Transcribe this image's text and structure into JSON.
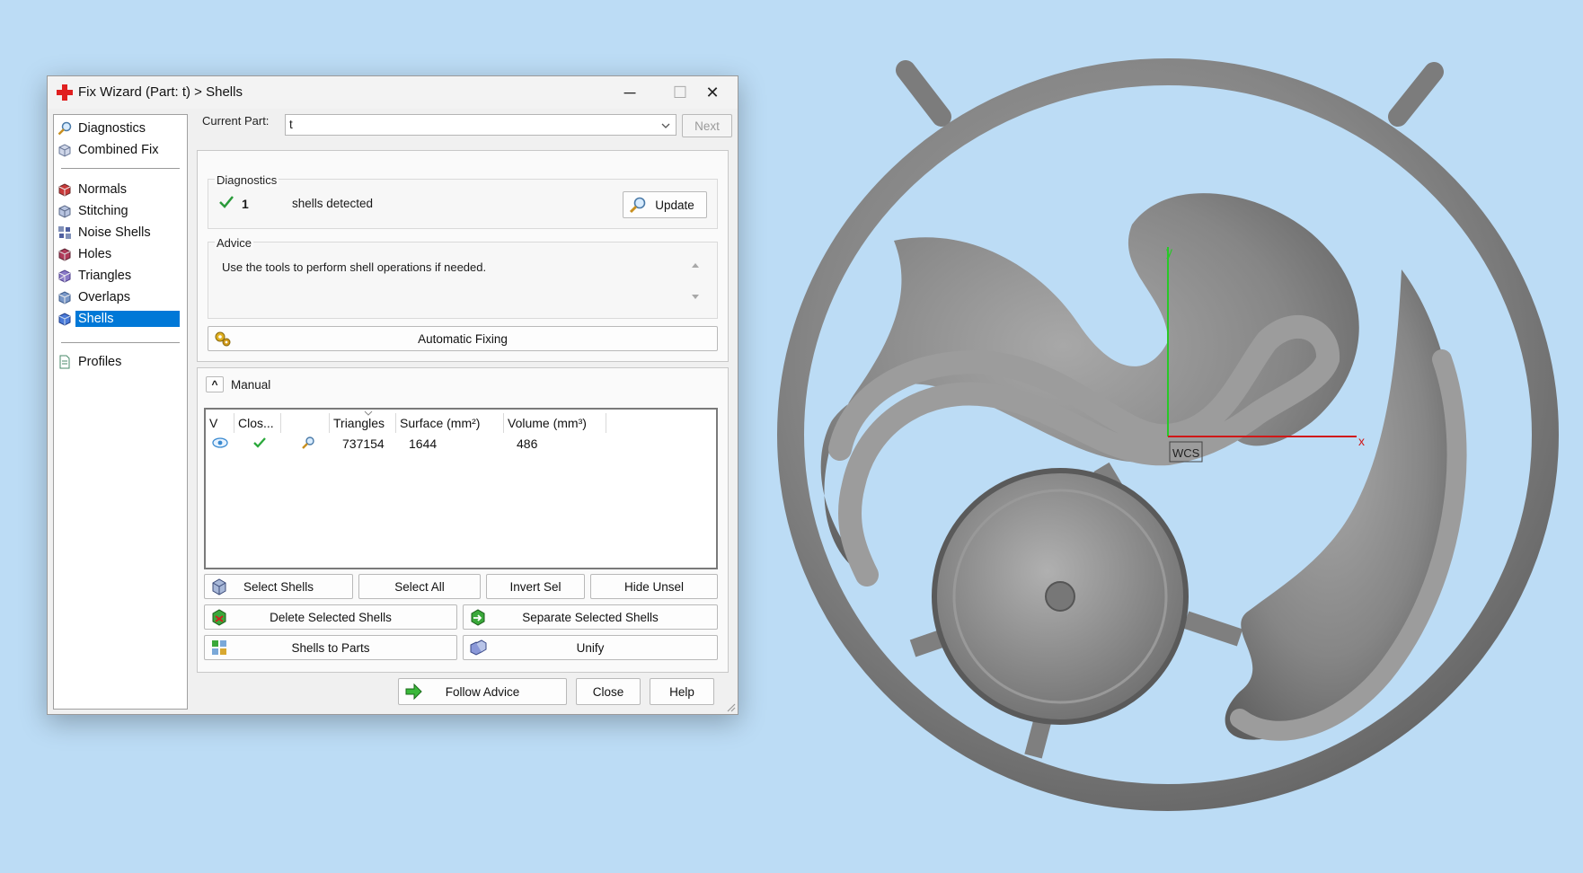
{
  "window": {
    "title": "Fix Wizard (Part: t) > Shells",
    "minimize_glyph": "─",
    "maximize_glyph": "☐",
    "close_glyph": "✕"
  },
  "sidebar": {
    "items": [
      {
        "label": "Diagnostics",
        "icon": "magnifier-icon"
      },
      {
        "label": "Combined Fix",
        "icon": "cube-icon"
      },
      {
        "label": "Normals",
        "icon": "normals-cube-icon"
      },
      {
        "label": "Stitching",
        "icon": "stitching-cube-icon"
      },
      {
        "label": "Noise Shells",
        "icon": "noise-shells-icon"
      },
      {
        "label": "Holes",
        "icon": "holes-cube-icon"
      },
      {
        "label": "Triangles",
        "icon": "triangles-cube-icon"
      },
      {
        "label": "Overlaps",
        "icon": "overlaps-cube-icon"
      },
      {
        "label": "Shells",
        "icon": "shells-cube-icon"
      },
      {
        "label": "Profiles",
        "icon": "document-icon"
      }
    ],
    "selected": "Shells"
  },
  "current_part": {
    "label": "Current Part:",
    "value": "t",
    "next_label": "Next"
  },
  "diagnostics": {
    "group_label": "Diagnostics",
    "count": "1",
    "message": "shells detected",
    "update_label": "Update"
  },
  "advice": {
    "group_label": "Advice",
    "text": "Use the tools to perform shell operations if needed."
  },
  "automatic_fixing_label": "Automatic Fixing",
  "manual": {
    "label": "Manual",
    "collapse_glyph": "^",
    "table": {
      "headers": [
        "V",
        "Clos...",
        "",
        "Triangles",
        "Surface (mm²)",
        "Volume (mm³)"
      ],
      "rows": [
        {
          "triangles": "737154",
          "surface": "1644",
          "volume": "486"
        }
      ]
    },
    "buttons": {
      "select_shells": "Select Shells",
      "select_all": "Select All",
      "invert_sel": "Invert Sel",
      "hide_unsel": "Hide Unsel",
      "delete_selected": "Delete Selected Shells",
      "separate_selected": "Separate Selected Shells",
      "shells_to_parts": "Shells to Parts",
      "unify": "Unify"
    }
  },
  "footer": {
    "follow_advice": "Follow Advice",
    "close": "Close",
    "help": "Help"
  },
  "viewport": {
    "axis_y_label": "y",
    "axis_x_label": "x",
    "wcs_label": "WCS",
    "colors": {
      "background": "#bcdcf5",
      "model": "#8a8a8a",
      "y_axis": "#28c828",
      "x_axis": "#d01818"
    }
  }
}
